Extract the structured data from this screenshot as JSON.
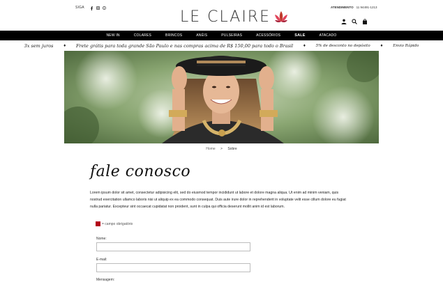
{
  "header": {
    "social_label": "SIGA",
    "logo_text": "LE CLAIRE",
    "attendance_label": "ATENDIMENTO",
    "attendance_phone": "11 94491-1213",
    "icons": [
      "user-icon",
      "search-icon",
      "shopping-bag-icon"
    ]
  },
  "nav": {
    "items": [
      {
        "label": "NEW IN"
      },
      {
        "label": "COLARES"
      },
      {
        "label": "BRINCOS"
      },
      {
        "label": "ANÉIS"
      },
      {
        "label": "PULSEIRAS"
      },
      {
        "label": "ACESSÓRIOS"
      },
      {
        "label": "SALE"
      },
      {
        "label": "ATACADO"
      }
    ]
  },
  "promo": {
    "items": [
      "3x sem juros",
      "Frete grátis para toda grande São Paulo e nas compras acima de R$ 150,00 para todo o Brasil",
      "5% de desconto no depósito",
      "Envio Rápido"
    ],
    "separator": "♦"
  },
  "breadcrumb": {
    "home": "Home",
    "separator": ">",
    "current": "Sobre"
  },
  "content": {
    "title": "fale conosco",
    "paragraph": "Lorem ipsum dolor sit amet, consectetur adipisicing elit, sed do eiusmod tempor incididunt ut labore et dolore magna aliqua. Ut enim ad minim veniam, quis nostrud exercitation ullamco laboris nisi ut aliquip ex ea commodo consequat. Duis aute irure dolor in reprehenderit in voluptate velit esse cillum dolore eu fugiat nulla pariatur. Excepteur sint occaecat cupidatat non proident, sunt in culpa qui officia deserunt mollit anim id est laborum.",
    "required_note": "= campo obrigatório"
  },
  "form": {
    "name_label": "Nome:",
    "name_value": "",
    "email_label": "E-mail:",
    "email_value": "",
    "message_label": "Mensagem:"
  },
  "colors": {
    "nav_bg": "#000000",
    "accent": "#b30018",
    "logo_flower": "#c0392b"
  }
}
